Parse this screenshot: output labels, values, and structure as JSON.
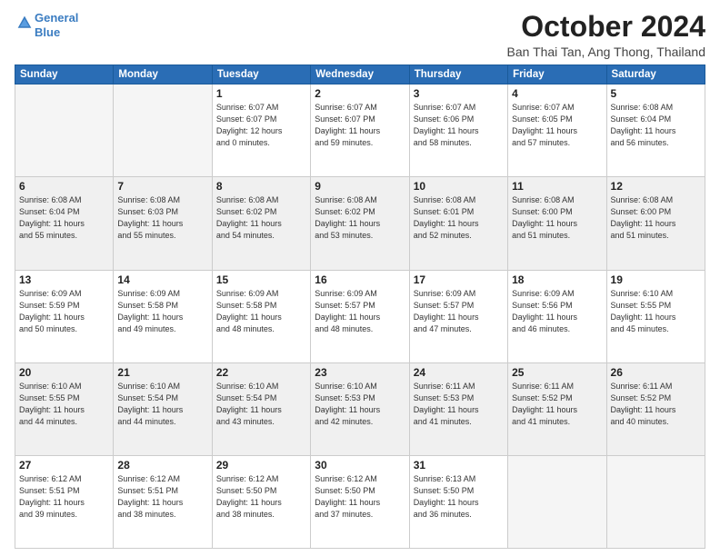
{
  "header": {
    "logo_line1": "General",
    "logo_line2": "Blue",
    "month": "October 2024",
    "location": "Ban Thai Tan, Ang Thong, Thailand"
  },
  "weekdays": [
    "Sunday",
    "Monday",
    "Tuesday",
    "Wednesday",
    "Thursday",
    "Friday",
    "Saturday"
  ],
  "weeks": [
    [
      {
        "day": "",
        "info": ""
      },
      {
        "day": "",
        "info": ""
      },
      {
        "day": "1",
        "info": "Sunrise: 6:07 AM\nSunset: 6:07 PM\nDaylight: 12 hours\nand 0 minutes."
      },
      {
        "day": "2",
        "info": "Sunrise: 6:07 AM\nSunset: 6:07 PM\nDaylight: 11 hours\nand 59 minutes."
      },
      {
        "day": "3",
        "info": "Sunrise: 6:07 AM\nSunset: 6:06 PM\nDaylight: 11 hours\nand 58 minutes."
      },
      {
        "day": "4",
        "info": "Sunrise: 6:07 AM\nSunset: 6:05 PM\nDaylight: 11 hours\nand 57 minutes."
      },
      {
        "day": "5",
        "info": "Sunrise: 6:08 AM\nSunset: 6:04 PM\nDaylight: 11 hours\nand 56 minutes."
      }
    ],
    [
      {
        "day": "6",
        "info": "Sunrise: 6:08 AM\nSunset: 6:04 PM\nDaylight: 11 hours\nand 55 minutes."
      },
      {
        "day": "7",
        "info": "Sunrise: 6:08 AM\nSunset: 6:03 PM\nDaylight: 11 hours\nand 55 minutes."
      },
      {
        "day": "8",
        "info": "Sunrise: 6:08 AM\nSunset: 6:02 PM\nDaylight: 11 hours\nand 54 minutes."
      },
      {
        "day": "9",
        "info": "Sunrise: 6:08 AM\nSunset: 6:02 PM\nDaylight: 11 hours\nand 53 minutes."
      },
      {
        "day": "10",
        "info": "Sunrise: 6:08 AM\nSunset: 6:01 PM\nDaylight: 11 hours\nand 52 minutes."
      },
      {
        "day": "11",
        "info": "Sunrise: 6:08 AM\nSunset: 6:00 PM\nDaylight: 11 hours\nand 51 minutes."
      },
      {
        "day": "12",
        "info": "Sunrise: 6:08 AM\nSunset: 6:00 PM\nDaylight: 11 hours\nand 51 minutes."
      }
    ],
    [
      {
        "day": "13",
        "info": "Sunrise: 6:09 AM\nSunset: 5:59 PM\nDaylight: 11 hours\nand 50 minutes."
      },
      {
        "day": "14",
        "info": "Sunrise: 6:09 AM\nSunset: 5:58 PM\nDaylight: 11 hours\nand 49 minutes."
      },
      {
        "day": "15",
        "info": "Sunrise: 6:09 AM\nSunset: 5:58 PM\nDaylight: 11 hours\nand 48 minutes."
      },
      {
        "day": "16",
        "info": "Sunrise: 6:09 AM\nSunset: 5:57 PM\nDaylight: 11 hours\nand 48 minutes."
      },
      {
        "day": "17",
        "info": "Sunrise: 6:09 AM\nSunset: 5:57 PM\nDaylight: 11 hours\nand 47 minutes."
      },
      {
        "day": "18",
        "info": "Sunrise: 6:09 AM\nSunset: 5:56 PM\nDaylight: 11 hours\nand 46 minutes."
      },
      {
        "day": "19",
        "info": "Sunrise: 6:10 AM\nSunset: 5:55 PM\nDaylight: 11 hours\nand 45 minutes."
      }
    ],
    [
      {
        "day": "20",
        "info": "Sunrise: 6:10 AM\nSunset: 5:55 PM\nDaylight: 11 hours\nand 44 minutes."
      },
      {
        "day": "21",
        "info": "Sunrise: 6:10 AM\nSunset: 5:54 PM\nDaylight: 11 hours\nand 44 minutes."
      },
      {
        "day": "22",
        "info": "Sunrise: 6:10 AM\nSunset: 5:54 PM\nDaylight: 11 hours\nand 43 minutes."
      },
      {
        "day": "23",
        "info": "Sunrise: 6:10 AM\nSunset: 5:53 PM\nDaylight: 11 hours\nand 42 minutes."
      },
      {
        "day": "24",
        "info": "Sunrise: 6:11 AM\nSunset: 5:53 PM\nDaylight: 11 hours\nand 41 minutes."
      },
      {
        "day": "25",
        "info": "Sunrise: 6:11 AM\nSunset: 5:52 PM\nDaylight: 11 hours\nand 41 minutes."
      },
      {
        "day": "26",
        "info": "Sunrise: 6:11 AM\nSunset: 5:52 PM\nDaylight: 11 hours\nand 40 minutes."
      }
    ],
    [
      {
        "day": "27",
        "info": "Sunrise: 6:12 AM\nSunset: 5:51 PM\nDaylight: 11 hours\nand 39 minutes."
      },
      {
        "day": "28",
        "info": "Sunrise: 6:12 AM\nSunset: 5:51 PM\nDaylight: 11 hours\nand 38 minutes."
      },
      {
        "day": "29",
        "info": "Sunrise: 6:12 AM\nSunset: 5:50 PM\nDaylight: 11 hours\nand 38 minutes."
      },
      {
        "day": "30",
        "info": "Sunrise: 6:12 AM\nSunset: 5:50 PM\nDaylight: 11 hours\nand 37 minutes."
      },
      {
        "day": "31",
        "info": "Sunrise: 6:13 AM\nSunset: 5:50 PM\nDaylight: 11 hours\nand 36 minutes."
      },
      {
        "day": "",
        "info": ""
      },
      {
        "day": "",
        "info": ""
      }
    ]
  ]
}
